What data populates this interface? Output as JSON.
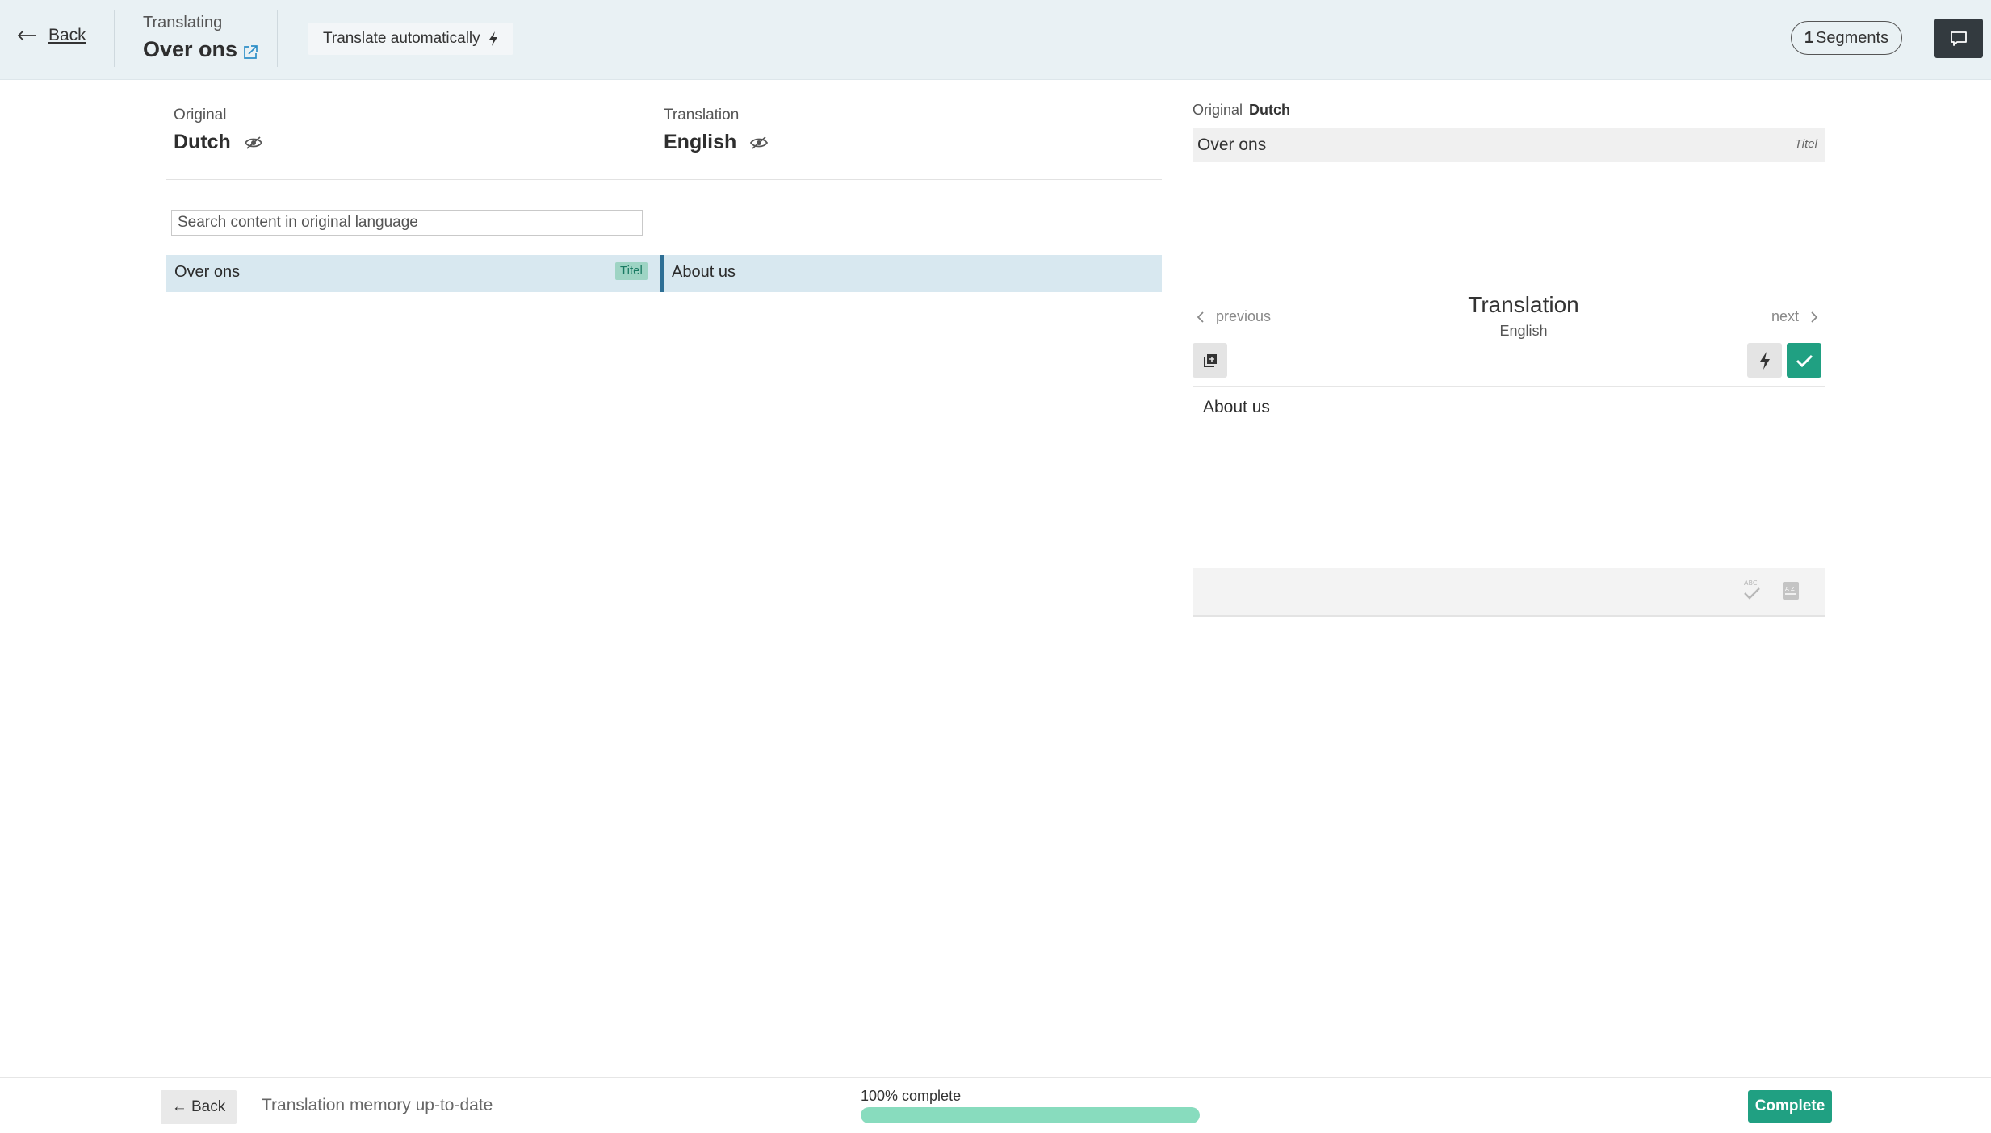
{
  "header": {
    "back_label": "Back",
    "kicker": "Translating",
    "title": "Over ons",
    "auto_translate_label": "Translate automatically",
    "segments_count": "1",
    "segments_label": "Segments"
  },
  "columns": {
    "original_kicker": "Original",
    "original_language": "Dutch",
    "translation_kicker": "Translation",
    "translation_language": "English"
  },
  "search": {
    "placeholder": "Search content in original language"
  },
  "segments": [
    {
      "original": "Over ons",
      "tag": "Titel",
      "translation": "About us"
    }
  ],
  "detail": {
    "original_kicker": "Original",
    "original_language": "Dutch",
    "original_text": "Over ons",
    "original_tag": "Titel",
    "previous_label": "previous",
    "next_label": "next",
    "translation_title": "Translation",
    "translation_language": "English",
    "translation_text": "About us"
  },
  "footer": {
    "back_label": "← Back",
    "memory_status": "Translation memory up-to-date",
    "progress_label": "100% complete",
    "progress_fraction": 1.0,
    "complete_label": "Complete"
  },
  "colors": {
    "header_bg": "#e9f1f4",
    "row_highlight": "#d8e8f0",
    "accent_green": "#20a082",
    "progress_fill": "#88dcbe",
    "link_blue": "#2e8fc7"
  }
}
